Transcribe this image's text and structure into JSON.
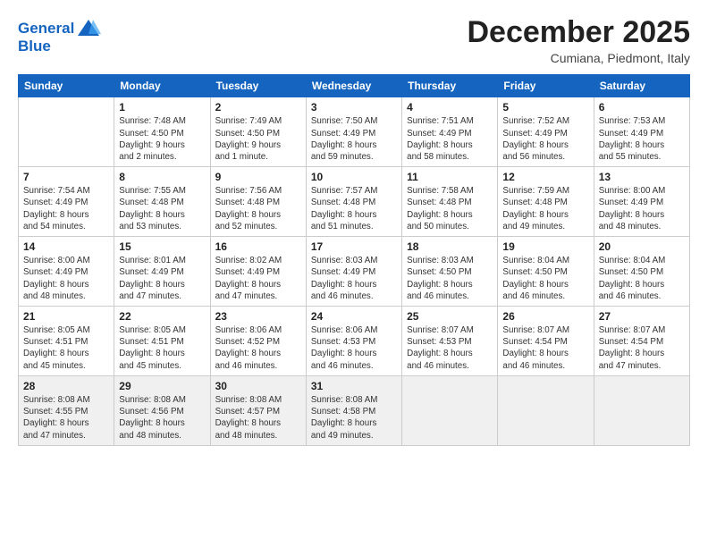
{
  "logo": {
    "line1": "General",
    "line2": "Blue"
  },
  "title": "December 2025",
  "location": "Cumiana, Piedmont, Italy",
  "days_of_week": [
    "Sunday",
    "Monday",
    "Tuesday",
    "Wednesday",
    "Thursday",
    "Friday",
    "Saturday"
  ],
  "weeks": [
    [
      {
        "day": "",
        "info": ""
      },
      {
        "day": "1",
        "info": "Sunrise: 7:48 AM\nSunset: 4:50 PM\nDaylight: 9 hours\nand 2 minutes."
      },
      {
        "day": "2",
        "info": "Sunrise: 7:49 AM\nSunset: 4:50 PM\nDaylight: 9 hours\nand 1 minute."
      },
      {
        "day": "3",
        "info": "Sunrise: 7:50 AM\nSunset: 4:49 PM\nDaylight: 8 hours\nand 59 minutes."
      },
      {
        "day": "4",
        "info": "Sunrise: 7:51 AM\nSunset: 4:49 PM\nDaylight: 8 hours\nand 58 minutes."
      },
      {
        "day": "5",
        "info": "Sunrise: 7:52 AM\nSunset: 4:49 PM\nDaylight: 8 hours\nand 56 minutes."
      },
      {
        "day": "6",
        "info": "Sunrise: 7:53 AM\nSunset: 4:49 PM\nDaylight: 8 hours\nand 55 minutes."
      }
    ],
    [
      {
        "day": "7",
        "info": "Sunrise: 7:54 AM\nSunset: 4:49 PM\nDaylight: 8 hours\nand 54 minutes."
      },
      {
        "day": "8",
        "info": "Sunrise: 7:55 AM\nSunset: 4:48 PM\nDaylight: 8 hours\nand 53 minutes."
      },
      {
        "day": "9",
        "info": "Sunrise: 7:56 AM\nSunset: 4:48 PM\nDaylight: 8 hours\nand 52 minutes."
      },
      {
        "day": "10",
        "info": "Sunrise: 7:57 AM\nSunset: 4:48 PM\nDaylight: 8 hours\nand 51 minutes."
      },
      {
        "day": "11",
        "info": "Sunrise: 7:58 AM\nSunset: 4:48 PM\nDaylight: 8 hours\nand 50 minutes."
      },
      {
        "day": "12",
        "info": "Sunrise: 7:59 AM\nSunset: 4:48 PM\nDaylight: 8 hours\nand 49 minutes."
      },
      {
        "day": "13",
        "info": "Sunrise: 8:00 AM\nSunset: 4:49 PM\nDaylight: 8 hours\nand 48 minutes."
      }
    ],
    [
      {
        "day": "14",
        "info": "Sunrise: 8:00 AM\nSunset: 4:49 PM\nDaylight: 8 hours\nand 48 minutes."
      },
      {
        "day": "15",
        "info": "Sunrise: 8:01 AM\nSunset: 4:49 PM\nDaylight: 8 hours\nand 47 minutes."
      },
      {
        "day": "16",
        "info": "Sunrise: 8:02 AM\nSunset: 4:49 PM\nDaylight: 8 hours\nand 47 minutes."
      },
      {
        "day": "17",
        "info": "Sunrise: 8:03 AM\nSunset: 4:49 PM\nDaylight: 8 hours\nand 46 minutes."
      },
      {
        "day": "18",
        "info": "Sunrise: 8:03 AM\nSunset: 4:50 PM\nDaylight: 8 hours\nand 46 minutes."
      },
      {
        "day": "19",
        "info": "Sunrise: 8:04 AM\nSunset: 4:50 PM\nDaylight: 8 hours\nand 46 minutes."
      },
      {
        "day": "20",
        "info": "Sunrise: 8:04 AM\nSunset: 4:50 PM\nDaylight: 8 hours\nand 46 minutes."
      }
    ],
    [
      {
        "day": "21",
        "info": "Sunrise: 8:05 AM\nSunset: 4:51 PM\nDaylight: 8 hours\nand 45 minutes."
      },
      {
        "day": "22",
        "info": "Sunrise: 8:05 AM\nSunset: 4:51 PM\nDaylight: 8 hours\nand 45 minutes."
      },
      {
        "day": "23",
        "info": "Sunrise: 8:06 AM\nSunset: 4:52 PM\nDaylight: 8 hours\nand 46 minutes."
      },
      {
        "day": "24",
        "info": "Sunrise: 8:06 AM\nSunset: 4:53 PM\nDaylight: 8 hours\nand 46 minutes."
      },
      {
        "day": "25",
        "info": "Sunrise: 8:07 AM\nSunset: 4:53 PM\nDaylight: 8 hours\nand 46 minutes."
      },
      {
        "day": "26",
        "info": "Sunrise: 8:07 AM\nSunset: 4:54 PM\nDaylight: 8 hours\nand 46 minutes."
      },
      {
        "day": "27",
        "info": "Sunrise: 8:07 AM\nSunset: 4:54 PM\nDaylight: 8 hours\nand 47 minutes."
      }
    ],
    [
      {
        "day": "28",
        "info": "Sunrise: 8:08 AM\nSunset: 4:55 PM\nDaylight: 8 hours\nand 47 minutes."
      },
      {
        "day": "29",
        "info": "Sunrise: 8:08 AM\nSunset: 4:56 PM\nDaylight: 8 hours\nand 48 minutes."
      },
      {
        "day": "30",
        "info": "Sunrise: 8:08 AM\nSunset: 4:57 PM\nDaylight: 8 hours\nand 48 minutes."
      },
      {
        "day": "31",
        "info": "Sunrise: 8:08 AM\nSunset: 4:58 PM\nDaylight: 8 hours\nand 49 minutes."
      },
      {
        "day": "",
        "info": ""
      },
      {
        "day": "",
        "info": ""
      },
      {
        "day": "",
        "info": ""
      }
    ]
  ]
}
